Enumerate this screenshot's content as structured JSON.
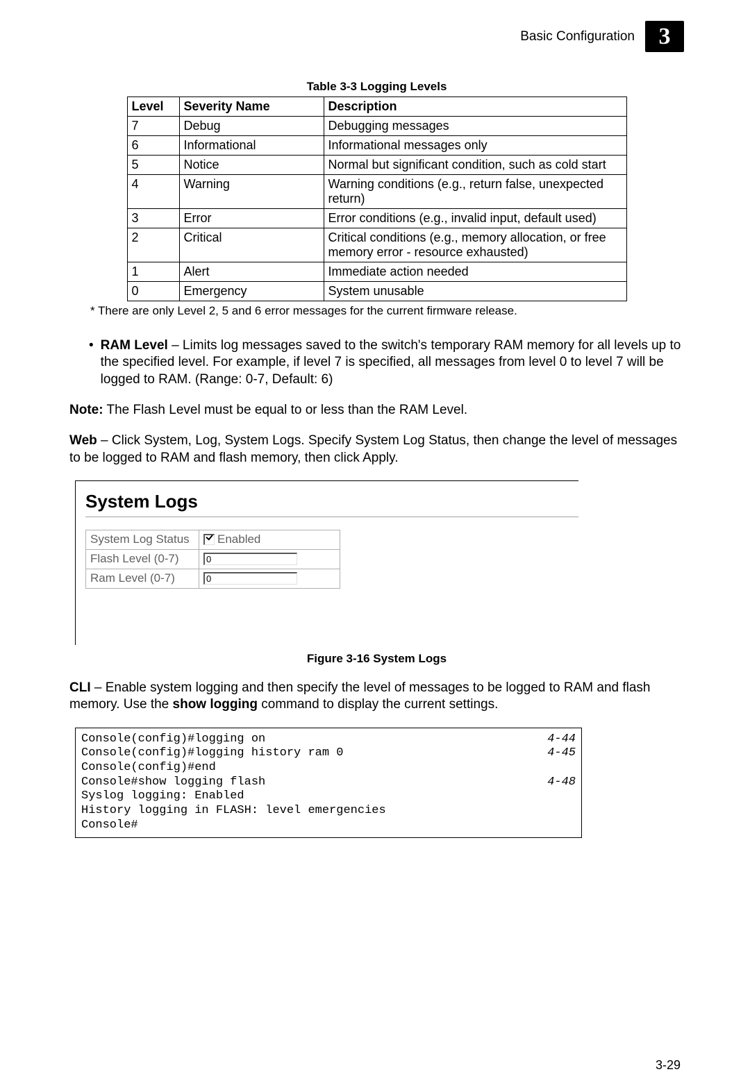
{
  "header": {
    "section_title": "Basic Configuration",
    "chapter_number": "3"
  },
  "table": {
    "caption": "Table 3-3  Logging Levels",
    "headers": {
      "level": "Level",
      "name": "Severity Name",
      "desc": "Description"
    },
    "rows": [
      {
        "level": "7",
        "name": "Debug",
        "desc": "Debugging messages"
      },
      {
        "level": "6",
        "name": "Informational",
        "desc": "Informational messages only"
      },
      {
        "level": "5",
        "name": "Notice",
        "desc": "Normal but significant condition, such as cold start"
      },
      {
        "level": "4",
        "name": "Warning",
        "desc": "Warning conditions (e.g., return false, unexpected return)"
      },
      {
        "level": "3",
        "name": "Error",
        "desc": "Error conditions (e.g., invalid input, default used)"
      },
      {
        "level": "2",
        "name": "Critical",
        "desc": "Critical conditions (e.g., memory allocation, or free memory error - resource exhausted)"
      },
      {
        "level": "1",
        "name": "Alert",
        "desc": "Immediate action needed"
      },
      {
        "level": "0",
        "name": "Emergency",
        "desc": "System unusable"
      }
    ],
    "footnote": "* There are only Level 2, 5 and 6 error messages for the current firmware release."
  },
  "bullet": {
    "mark": "•",
    "term": "RAM Level",
    "dash": " – ",
    "text": "Limits log messages saved to the switch's temporary RAM memory for all levels up to the specified level. For example, if level 7 is specified, all messages from level 0 to level 7 will be logged to RAM. (Range: 0-7, Default: 6)"
  },
  "note": {
    "label": "Note:",
    "text": " The Flash Level must be equal to or less than the RAM Level."
  },
  "web": {
    "label": "Web",
    "dash": " – ",
    "text": "Click System, Log, System Logs. Specify System Log Status, then change the level of messages to be logged to RAM and flash memory, then click Apply."
  },
  "webfig": {
    "heading": "System Logs",
    "rows": {
      "status_label": "System Log Status",
      "status_value": "Enabled",
      "flash_label": "Flash Level (0-7)",
      "flash_value": "0",
      "ram_label": "Ram Level (0-7)",
      "ram_value": "0"
    },
    "caption": "Figure 3-16  System Logs"
  },
  "cli": {
    "label": "CLI",
    "dash": " – ",
    "text1": "Enable system logging and then specify the level of messages to be logged to RAM and flash memory. Use the ",
    "cmd": "show logging",
    "text2": " command to display the current settings."
  },
  "code": {
    "lines": [
      {
        "t": "Console(config)#logging on",
        "r": "4-44"
      },
      {
        "t": "Console(config)#logging history ram 0",
        "r": "4-45"
      },
      {
        "t": "Console(config)#end",
        "r": ""
      },
      {
        "t": "Console#show logging flash",
        "r": "4-48"
      },
      {
        "t": "Syslog logging: Enabled",
        "r": ""
      },
      {
        "t": "History logging in FLASH: level emergencies",
        "r": ""
      },
      {
        "t": "Console#",
        "r": ""
      }
    ]
  },
  "page_number": "3-29"
}
